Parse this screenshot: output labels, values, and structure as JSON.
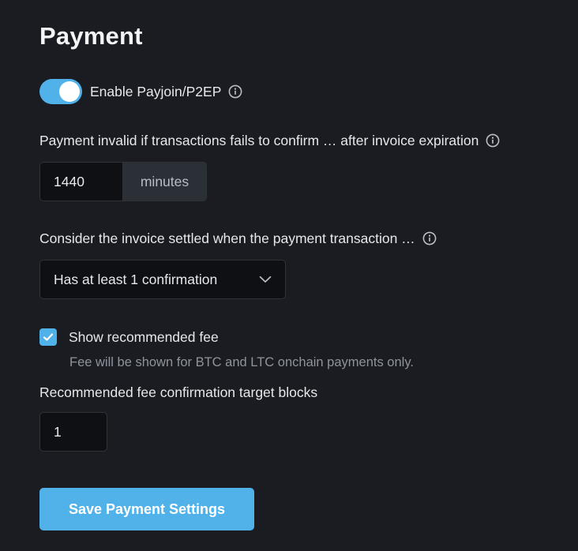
{
  "page": {
    "title": "Payment"
  },
  "payjoin": {
    "label": "Enable Payjoin/P2EP",
    "enabled": true
  },
  "expiration": {
    "label": "Payment invalid if transactions fails to confirm … after invoice expiration",
    "value": "1440",
    "unit": "minutes"
  },
  "settled": {
    "label": "Consider the invoice settled when the payment transaction …",
    "selected": "Has at least 1 confirmation"
  },
  "recommended_fee": {
    "label": "Show recommended fee",
    "checked": true,
    "help": "Fee will be shown for BTC and LTC onchain payments only."
  },
  "target_blocks": {
    "label": "Recommended fee confirmation target blocks",
    "value": "1"
  },
  "actions": {
    "save_label": "Save Payment Settings"
  },
  "colors": {
    "background": "#1a1c21",
    "accent": "#51b2ea",
    "input_bg": "#0e1013",
    "addon_bg": "#2b2f36",
    "muted_text": "#8e949c"
  },
  "icons": {
    "info": "info-circle-icon",
    "chevron": "chevron-down-icon",
    "check": "check-icon"
  }
}
